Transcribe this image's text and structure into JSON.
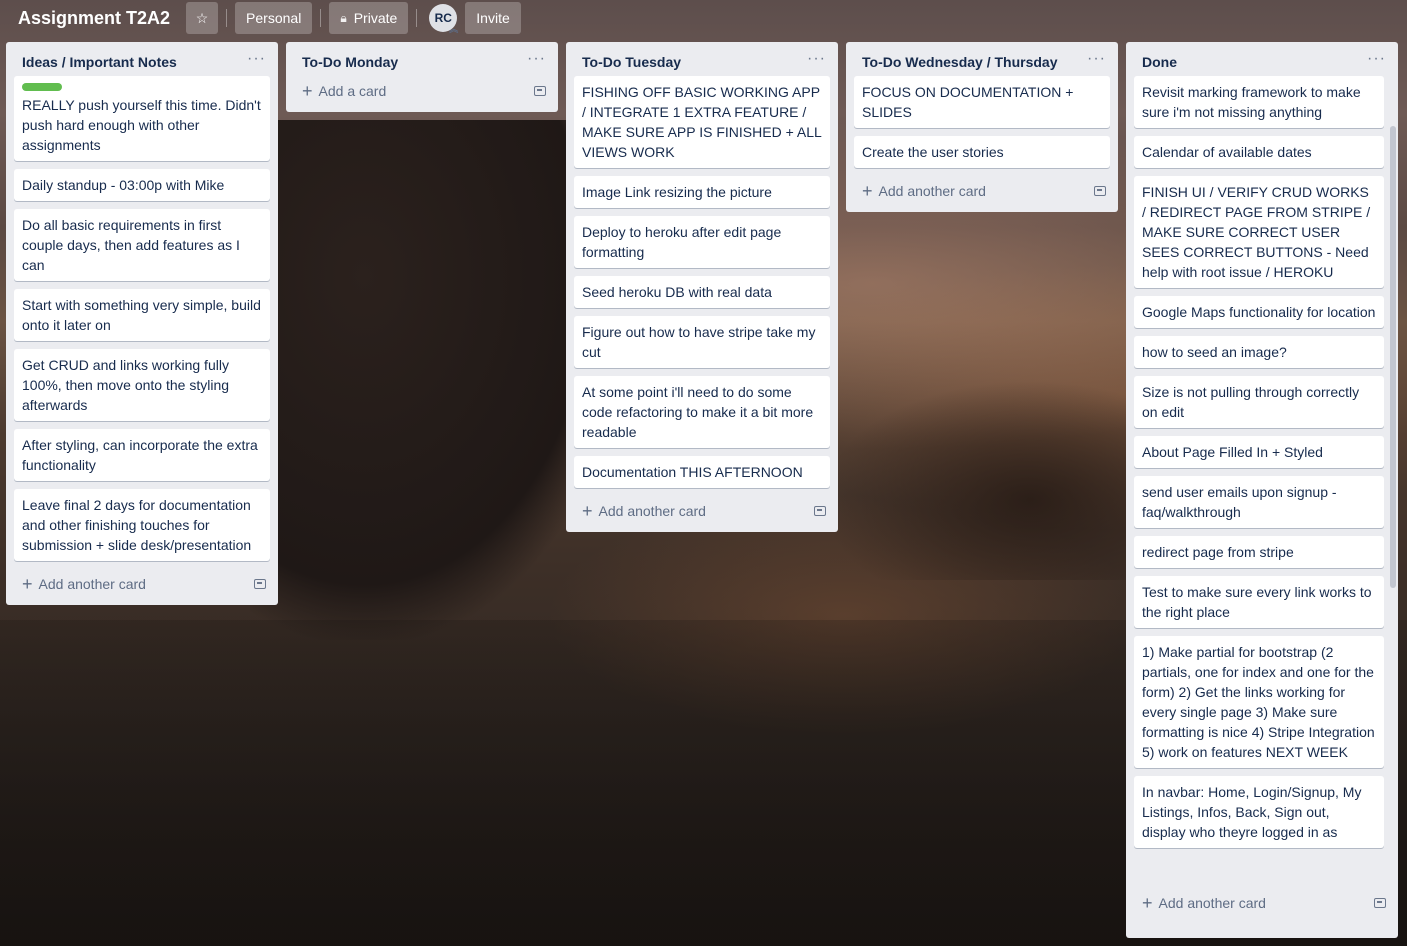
{
  "board": {
    "title": "Assignment T2A2",
    "workspace_label": "Personal",
    "visibility_label": "Private",
    "avatar_initials": "RC",
    "invite_label": "Invite"
  },
  "lists": [
    {
      "title": "Ideas / Important Notes",
      "cards": [
        "REALLY push yourself this time. Didn't push hard enough with other assignments",
        "Daily standup - 03:00p with Mike",
        "Do all basic requirements in first couple days, then add features as I can",
        "Start with something very simple, build onto it later on",
        "Get CRUD and links working fully 100%, then move onto the styling afterwards",
        "After styling, can incorporate the extra functionality",
        "Leave final 2 days for documentation and other finishing touches for submission + slide desk/presentation"
      ],
      "add_label": "Add another card"
    },
    {
      "title": "To-Do Monday",
      "cards": [],
      "add_label": "Add a card"
    },
    {
      "title": "To-Do Tuesday",
      "cards": [
        "FISHING OFF BASIC WORKING APP / INTEGRATE 1 EXTRA FEATURE / MAKE SURE APP IS FINISHED + ALL VIEWS WORK",
        "Image Link resizing the picture",
        "Deploy to heroku after edit page formatting",
        "Seed heroku DB with real data",
        "Figure out how to have stripe take my cut",
        "At some point i'll need to do some code refactoring to make it a bit more readable",
        "Documentation THIS AFTERNOON"
      ],
      "add_label": "Add another card"
    },
    {
      "title": "To-Do Wednesday / Thursday",
      "cards": [
        "FOCUS ON DOCUMENTATION + SLIDES",
        "Create the user stories"
      ],
      "add_label": "Add another card"
    },
    {
      "title": "Done",
      "cards": [
        "Revisit marking framework to make sure i'm not missing anything",
        "Calendar of available dates",
        "FINISH UI / VERIFY CRUD WORKS / REDIRECT PAGE FROM STRIPE / MAKE SURE CORRECT USER SEES CORRECT BUTTONS - Need help with root issue / HEROKU",
        "Google Maps functionality for location",
        "how to seed an image?",
        "Size is not pulling through correctly on edit",
        "About Page Filled In + Styled",
        "send user emails upon signup - faq/walkthrough",
        "redirect page from stripe",
        "Test to make sure every link works to the right place",
        "1) Make partial for bootstrap (2 partials, one for index and one for the form) 2) Get the links working for every single page 3) Make sure formatting is nice 4) Stripe Integration 5) work on features NEXT WEEK",
        "In navbar: Home, Login/Signup, My Listings, Infos, Back, Sign out, display who theyre logged in as"
      ],
      "add_label": "Add another card"
    }
  ],
  "colors": {
    "list_bg": "#ebecf0",
    "card_bg": "#ffffff",
    "label_green": "#61bd4f",
    "text": "#172b4d"
  }
}
